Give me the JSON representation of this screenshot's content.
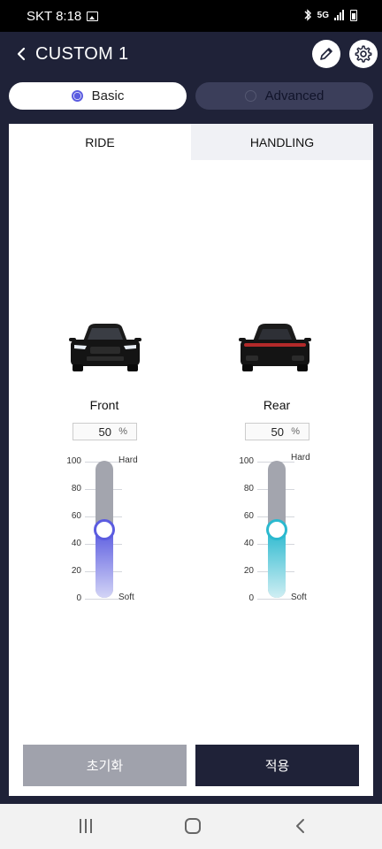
{
  "status_bar": {
    "carrier_time": "SKT 8:18",
    "network": "5G"
  },
  "header": {
    "title": "CUSTOM 1"
  },
  "modes": {
    "basic": "Basic",
    "advanced": "Advanced",
    "selected": "Basic"
  },
  "tabs": {
    "ride": "RIDE",
    "handling": "HANDLING",
    "active": "RIDE"
  },
  "front": {
    "label": "Front",
    "value": "50",
    "unit": "%",
    "level": 50
  },
  "rear": {
    "label": "Rear",
    "value": "50",
    "unit": "%",
    "level": 50
  },
  "slider_scale": {
    "ticks": [
      "100",
      "80",
      "60",
      "40",
      "20",
      "0"
    ],
    "hard": "Hard",
    "soft": "Soft"
  },
  "buttons": {
    "reset": "초기화",
    "apply": "적용"
  },
  "colors": {
    "front_accent": "#5b5ce0",
    "rear_accent": "#2bb9cf",
    "header_bg": "#1f2238"
  },
  "icons": {
    "back": "chevron-left-icon",
    "edit": "pencil-icon",
    "settings": "gear-icon"
  }
}
